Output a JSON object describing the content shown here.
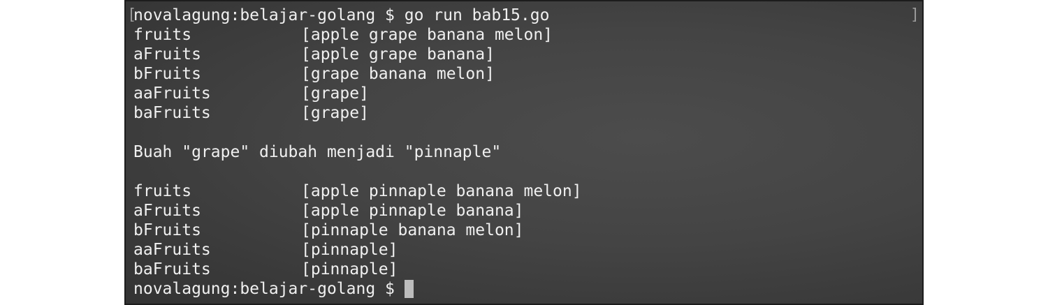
{
  "terminal": {
    "bracket_left": "[",
    "bracket_right": "]",
    "command_line": {
      "prompt": "novalagung:belajar-golang $ ",
      "command": "go run bab15.go"
    },
    "block1": [
      {
        "name": "fruits",
        "value": "[apple grape banana melon]"
      },
      {
        "name": "aFruits",
        "value": "[apple grape banana]"
      },
      {
        "name": "bFruits",
        "value": "[grape banana melon]"
      },
      {
        "name": "aaFruits",
        "value": "[grape]"
      },
      {
        "name": "baFruits",
        "value": "[grape]"
      }
    ],
    "message": "Buah \"grape\" diubah menjadi \"pinnaple\"",
    "block2": [
      {
        "name": "fruits",
        "value": "[apple pinnaple banana melon]"
      },
      {
        "name": "aFruits",
        "value": "[apple pinnaple banana]"
      },
      {
        "name": "bFruits",
        "value": "[pinnaple banana melon]"
      },
      {
        "name": "aaFruits",
        "value": "[pinnaple]"
      },
      {
        "name": "baFruits",
        "value": "[pinnaple]"
      }
    ],
    "final_prompt": "novalagung:belajar-golang $ "
  }
}
